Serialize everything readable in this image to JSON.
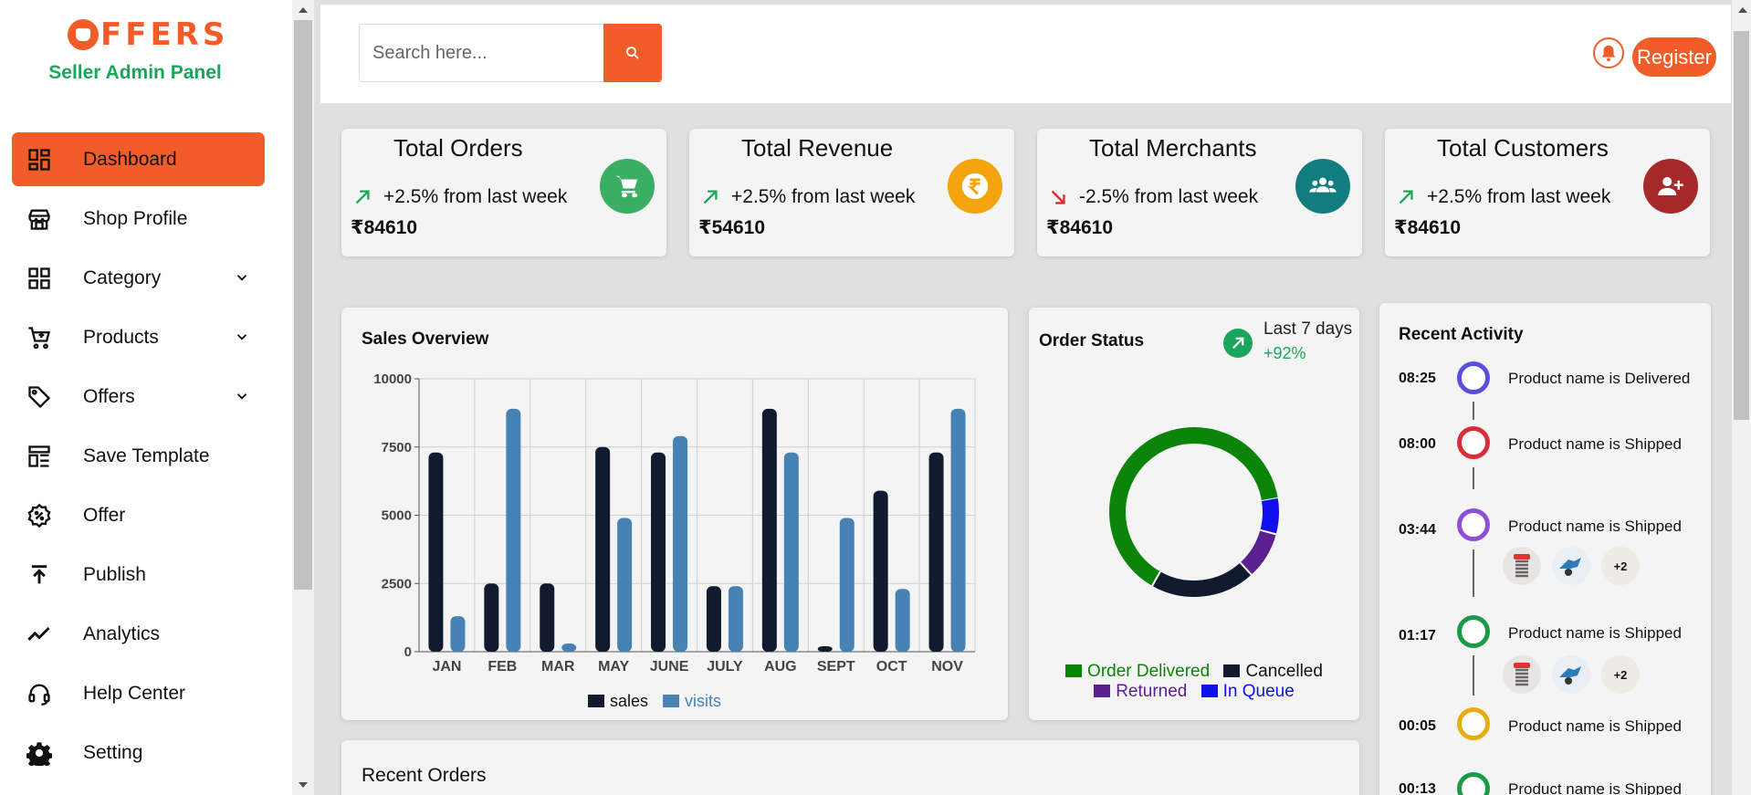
{
  "brand": {
    "logo_text": "FFERS",
    "subtitle": "Seller Admin Panel",
    "accent": "#f25c29",
    "green": "#1aa65a"
  },
  "sidebar": {
    "items": [
      {
        "label": "Dashboard",
        "icon": "dashboard-icon",
        "active": true
      },
      {
        "label": "Shop Profile",
        "icon": "store-icon"
      },
      {
        "label": "Category",
        "icon": "category-icon",
        "dropdown": true
      },
      {
        "label": "Products",
        "icon": "cart-icon",
        "dropdown": true
      },
      {
        "label": "Offers",
        "icon": "tag-icon",
        "dropdown": true
      },
      {
        "label": "Save Template",
        "icon": "template-icon"
      },
      {
        "label": "Offer",
        "icon": "discount-icon"
      },
      {
        "label": "Publish",
        "icon": "publish-icon"
      },
      {
        "label": "Analytics",
        "icon": "analytics-icon"
      },
      {
        "label": "Help Center",
        "icon": "headset-icon"
      },
      {
        "label": "Setting",
        "icon": "gear-icon"
      }
    ]
  },
  "header": {
    "search_placeholder": "Search here...",
    "register_label": "Register"
  },
  "stats": [
    {
      "title": "Total Orders",
      "trend": "+2.5% from last week",
      "direction": "up",
      "value": "₹84610",
      "icon": "cart-icon",
      "color": "#3aae63"
    },
    {
      "title": "Total Revenue",
      "trend": "+2.5% from last week",
      "direction": "up",
      "value": "₹54610",
      "icon": "rupee-icon",
      "color": "#f5a30b"
    },
    {
      "title": "Total Merchants",
      "trend": "-2.5% from last week",
      "direction": "down",
      "value": "₹84610",
      "icon": "people-icon",
      "color": "#117d7e"
    },
    {
      "title": "Total Customers",
      "trend": "+2.5% from last week",
      "direction": "up",
      "value": "₹84610",
      "icon": "add-user-icon",
      "color": "#a52b2b"
    }
  ],
  "sales": {
    "title": "Sales Overview",
    "legend": {
      "sales": "sales",
      "visits": "visits"
    }
  },
  "chart_data": {
    "type": "bar",
    "title": "Sales Overview",
    "categories": [
      "JAN",
      "FEB",
      "MAR",
      "MAY",
      "JUNE",
      "JULY",
      "AUG",
      "SEPT",
      "OCT",
      "NOV"
    ],
    "series": [
      {
        "name": "sales",
        "color": "#111a2e",
        "values": [
          7300,
          2500,
          2500,
          7500,
          7300,
          2400,
          8900,
          200,
          5900,
          7300
        ]
      },
      {
        "name": "visits",
        "color": "#4682b4",
        "values": [
          1300,
          8900,
          300,
          4900,
          7900,
          2400,
          7300,
          4900,
          2300,
          8900
        ]
      }
    ],
    "yticks": [
      "0",
      "2500",
      "5000",
      "7500",
      "10000"
    ],
    "ylim": [
      0,
      10000
    ],
    "grid": true,
    "legend_position": "bottom"
  },
  "order_status": {
    "title": "Order Status",
    "period": "Last 7 days",
    "change": "+92%",
    "legend": [
      {
        "label": "Order Delivered",
        "color": "#0a850a",
        "fraction": 0.64
      },
      {
        "label": "Cancelled",
        "color": "#111a2e",
        "fraction": 0.2
      },
      {
        "label": "Returned",
        "color": "#5b1f8f",
        "fraction": 0.09
      },
      {
        "label": "In Queue",
        "color": "#1010ee",
        "fraction": 0.07
      }
    ]
  },
  "activity": {
    "title": "Recent Activity",
    "items": [
      {
        "time": "08:25",
        "text": "Product name is Delivered",
        "color": "#5a4fdc"
      },
      {
        "time": "08:00",
        "text": "Product name is Shipped",
        "color": "#d92e36"
      },
      {
        "time": "03:44",
        "text": "Product name is Shipped",
        "color": "#8e4fd8",
        "more": "+2"
      },
      {
        "time": "01:17",
        "text": "Product name is Shipped",
        "color": "#1a9a46",
        "more": "+2"
      },
      {
        "time": "00:05",
        "text": "Product name is Shipped",
        "color": "#e5ad10"
      },
      {
        "time": "00:13",
        "text": "Product name is Shipped",
        "color": "#1a9a46"
      }
    ]
  },
  "recent_orders": {
    "title": "Recent Orders"
  }
}
